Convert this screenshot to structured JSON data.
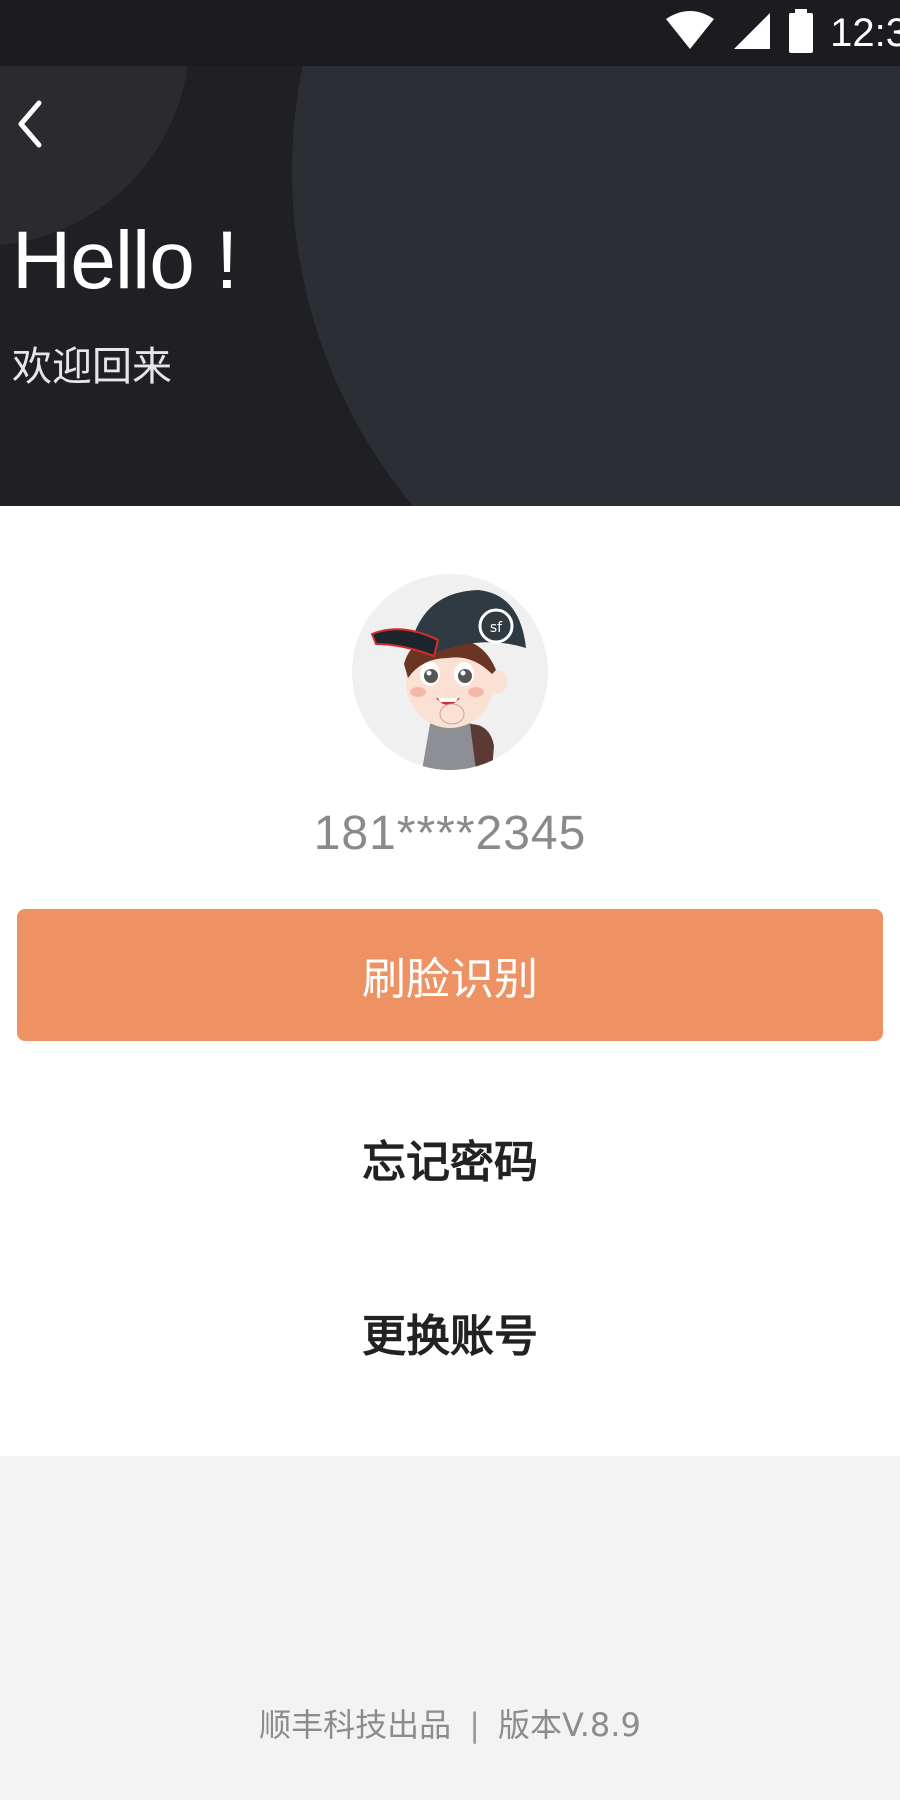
{
  "status_bar": {
    "time": "12:3"
  },
  "header": {
    "greeting": "Hello !",
    "subtitle": "欢迎回来"
  },
  "account": {
    "phone": "181****2345"
  },
  "actions": {
    "face_login": "刷脸识别",
    "forgot_password": "忘记密码",
    "switch_account": "更换账号"
  },
  "footer": {
    "producer": "顺丰科技出品",
    "separator": "|",
    "version": "版本V.8.9"
  },
  "colors": {
    "accent": "#ee9264",
    "header_bg": "#1f1f24",
    "text_primary": "#222222",
    "text_muted": "#8a8a8a"
  }
}
